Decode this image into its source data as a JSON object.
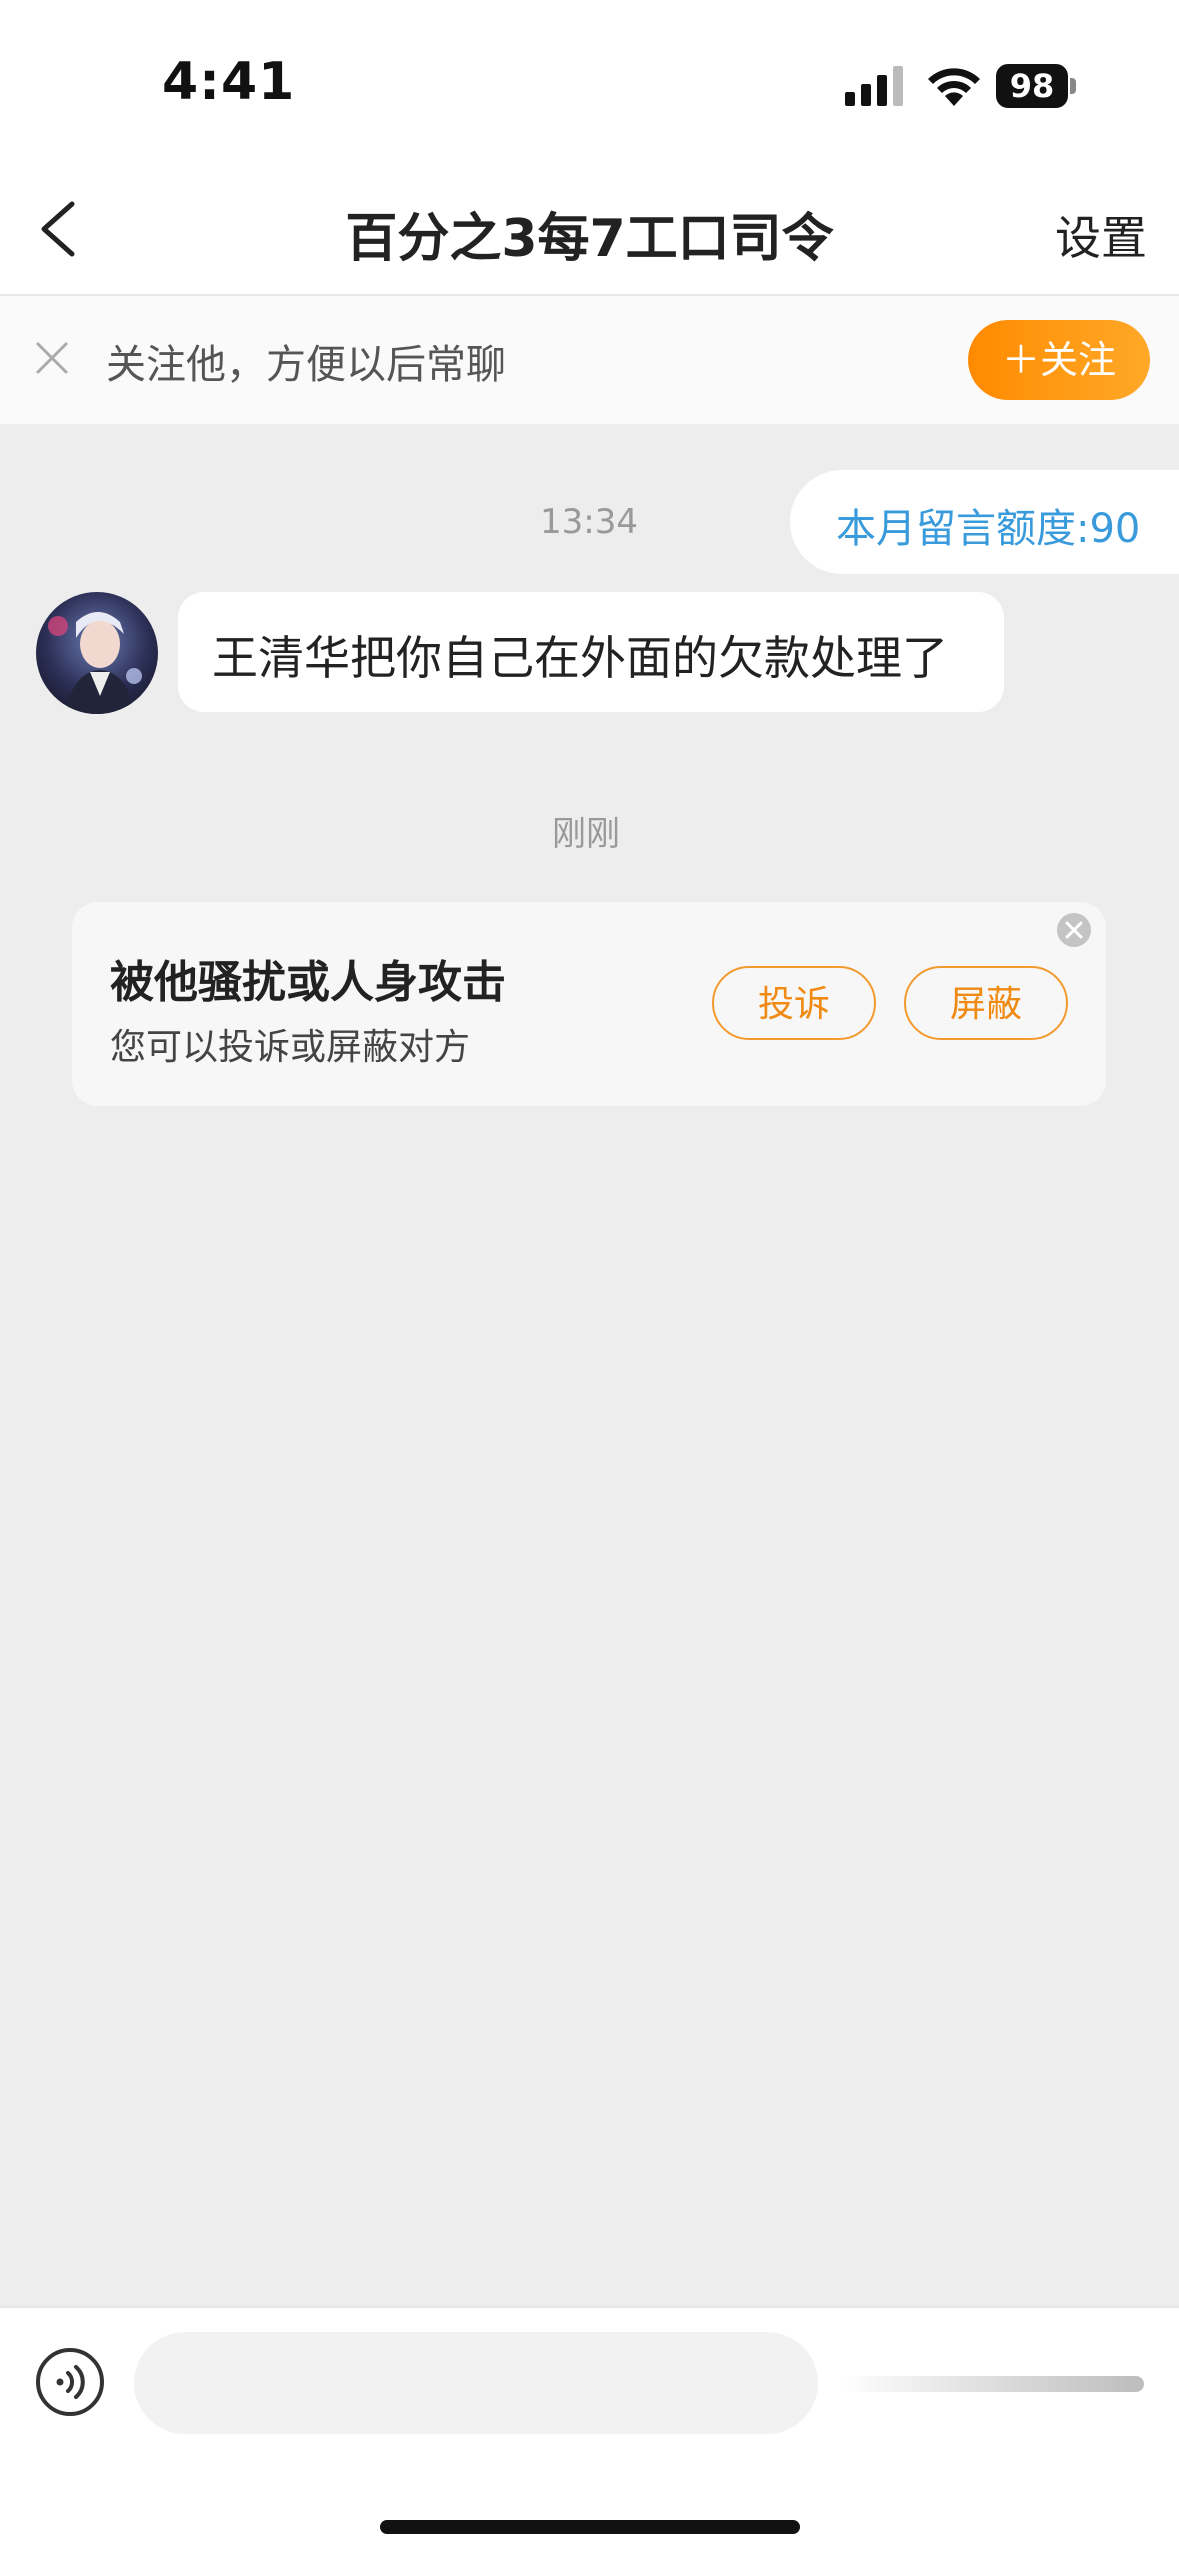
{
  "status_bar": {
    "time": "4:41",
    "battery": "98"
  },
  "nav": {
    "title": "百分之3每7工口司令",
    "settings_label": "设置"
  },
  "follow_banner": {
    "text": "关注他，方便以后常聊",
    "button_label": "＋关注"
  },
  "chat": {
    "timestamp_1": "13:34",
    "quota_text": "本月留言额度:90",
    "message_1": "王清华把你自己在外面的欠款处理了",
    "timestamp_2": "刚刚"
  },
  "harassment_card": {
    "title": "被他骚扰或人身攻击",
    "subtitle": "您可以投诉或屏蔽对方",
    "report_label": "投诉",
    "block_label": "屏蔽"
  },
  "input_bar": {
    "placeholder": ""
  },
  "colors": {
    "accent_orange": "#ff8a00",
    "quota_blue": "#3a9bdc",
    "background": "#ededed"
  }
}
